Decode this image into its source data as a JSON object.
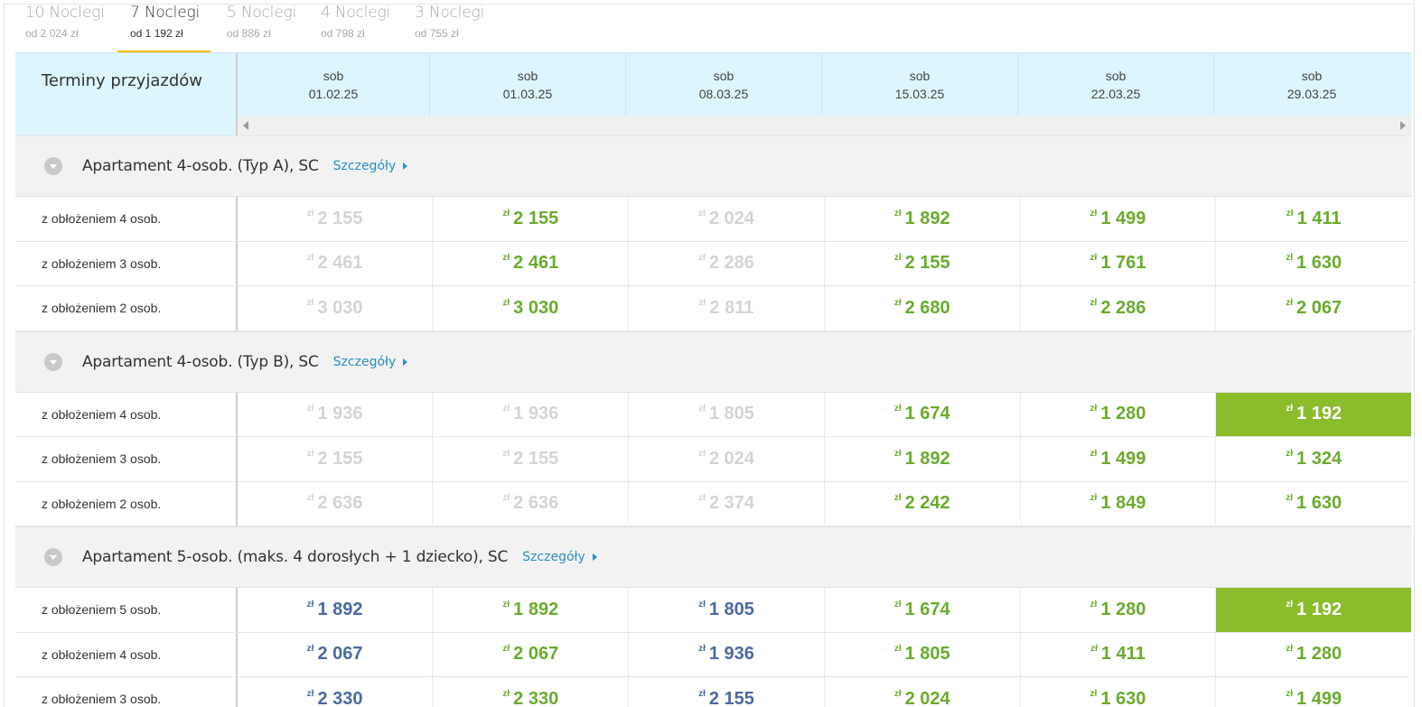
{
  "tabs": [
    {
      "title": "10 Noclegi",
      "sub": "od 2 024 zł",
      "active": false
    },
    {
      "title": "7 Noclegi",
      "sub": "od 1 192 zł",
      "active": true
    },
    {
      "title": "5 Noclegi",
      "sub": "od 886 zł",
      "active": false
    },
    {
      "title": "4 Noclegi",
      "sub": "od 798 zł",
      "active": false
    },
    {
      "title": "3 Noclegi",
      "sub": "od 755 zł",
      "active": false
    }
  ],
  "header": {
    "label": "Terminy przyjazdów",
    "dates": [
      {
        "day": "sob",
        "date": "01.02.25"
      },
      {
        "day": "sob",
        "date": "01.03.25"
      },
      {
        "day": "sob",
        "date": "08.03.25"
      },
      {
        "day": "sob",
        "date": "15.03.25"
      },
      {
        "day": "sob",
        "date": "22.03.25"
      },
      {
        "day": "sob",
        "date": "29.03.25"
      }
    ]
  },
  "currency": "zł",
  "details_label": "Szczegóły",
  "colors": {
    "available": "#6aac2d",
    "unavailable": "#d4d4d4",
    "alternative": "#4a6aa3",
    "best": "#8bbc2c",
    "active_tab": "#f3b600",
    "link": "#2b8fc5"
  },
  "sections": [
    {
      "title": "Apartament 4-osob. (Typ A), SC",
      "rows": [
        {
          "label": "z obłożeniem 4 osob.",
          "prices": [
            {
              "v": "2 155",
              "s": "unavail"
            },
            {
              "v": "2 155",
              "s": "avail"
            },
            {
              "v": "2 024",
              "s": "unavail"
            },
            {
              "v": "1 892",
              "s": "avail"
            },
            {
              "v": "1 499",
              "s": "avail"
            },
            {
              "v": "1 411",
              "s": "avail"
            }
          ]
        },
        {
          "label": "z obłożeniem 3 osob.",
          "prices": [
            {
              "v": "2 461",
              "s": "unavail"
            },
            {
              "v": "2 461",
              "s": "avail"
            },
            {
              "v": "2 286",
              "s": "unavail"
            },
            {
              "v": "2 155",
              "s": "avail"
            },
            {
              "v": "1 761",
              "s": "avail"
            },
            {
              "v": "1 630",
              "s": "avail"
            }
          ]
        },
        {
          "label": "z obłożeniem 2 osob.",
          "prices": [
            {
              "v": "3 030",
              "s": "unavail"
            },
            {
              "v": "3 030",
              "s": "avail"
            },
            {
              "v": "2 811",
              "s": "unavail"
            },
            {
              "v": "2 680",
              "s": "avail"
            },
            {
              "v": "2 286",
              "s": "avail"
            },
            {
              "v": "2 067",
              "s": "avail"
            }
          ]
        }
      ]
    },
    {
      "title": "Apartament 4-osob. (Typ B), SC",
      "rows": [
        {
          "label": "z obłożeniem 4 osob.",
          "prices": [
            {
              "v": "1 936",
              "s": "unavail"
            },
            {
              "v": "1 936",
              "s": "unavail"
            },
            {
              "v": "1 805",
              "s": "unavail"
            },
            {
              "v": "1 674",
              "s": "avail"
            },
            {
              "v": "1 280",
              "s": "avail"
            },
            {
              "v": "1 192",
              "s": "best"
            }
          ]
        },
        {
          "label": "z obłożeniem 3 osob.",
          "prices": [
            {
              "v": "2 155",
              "s": "unavail"
            },
            {
              "v": "2 155",
              "s": "unavail"
            },
            {
              "v": "2 024",
              "s": "unavail"
            },
            {
              "v": "1 892",
              "s": "avail"
            },
            {
              "v": "1 499",
              "s": "avail"
            },
            {
              "v": "1 324",
              "s": "avail"
            }
          ]
        },
        {
          "label": "z obłożeniem 2 osob.",
          "prices": [
            {
              "v": "2 636",
              "s": "unavail"
            },
            {
              "v": "2 636",
              "s": "unavail"
            },
            {
              "v": "2 374",
              "s": "unavail"
            },
            {
              "v": "2 242",
              "s": "avail"
            },
            {
              "v": "1 849",
              "s": "avail"
            },
            {
              "v": "1 630",
              "s": "avail"
            }
          ]
        }
      ]
    },
    {
      "title": "Apartament 5-osob. (maks. 4 dorosłych + 1 dziecko), SC",
      "rows": [
        {
          "label": "z obłożeniem 5 osob.",
          "prices": [
            {
              "v": "1 892",
              "s": "blue"
            },
            {
              "v": "1 892",
              "s": "avail"
            },
            {
              "v": "1 805",
              "s": "blue"
            },
            {
              "v": "1 674",
              "s": "avail"
            },
            {
              "v": "1 280",
              "s": "avail"
            },
            {
              "v": "1 192",
              "s": "best"
            }
          ]
        },
        {
          "label": "z obłożeniem 4 osob.",
          "prices": [
            {
              "v": "2 067",
              "s": "blue"
            },
            {
              "v": "2 067",
              "s": "avail"
            },
            {
              "v": "1 936",
              "s": "blue"
            },
            {
              "v": "1 805",
              "s": "avail"
            },
            {
              "v": "1 411",
              "s": "avail"
            },
            {
              "v": "1 280",
              "s": "avail"
            }
          ]
        },
        {
          "label": "z obłożeniem 3 osob.",
          "prices": [
            {
              "v": "2 330",
              "s": "blue"
            },
            {
              "v": "2 330",
              "s": "avail"
            },
            {
              "v": "2 155",
              "s": "blue"
            },
            {
              "v": "2 024",
              "s": "avail"
            },
            {
              "v": "1 630",
              "s": "avail"
            },
            {
              "v": "1 499",
              "s": "avail"
            }
          ]
        }
      ]
    }
  ]
}
